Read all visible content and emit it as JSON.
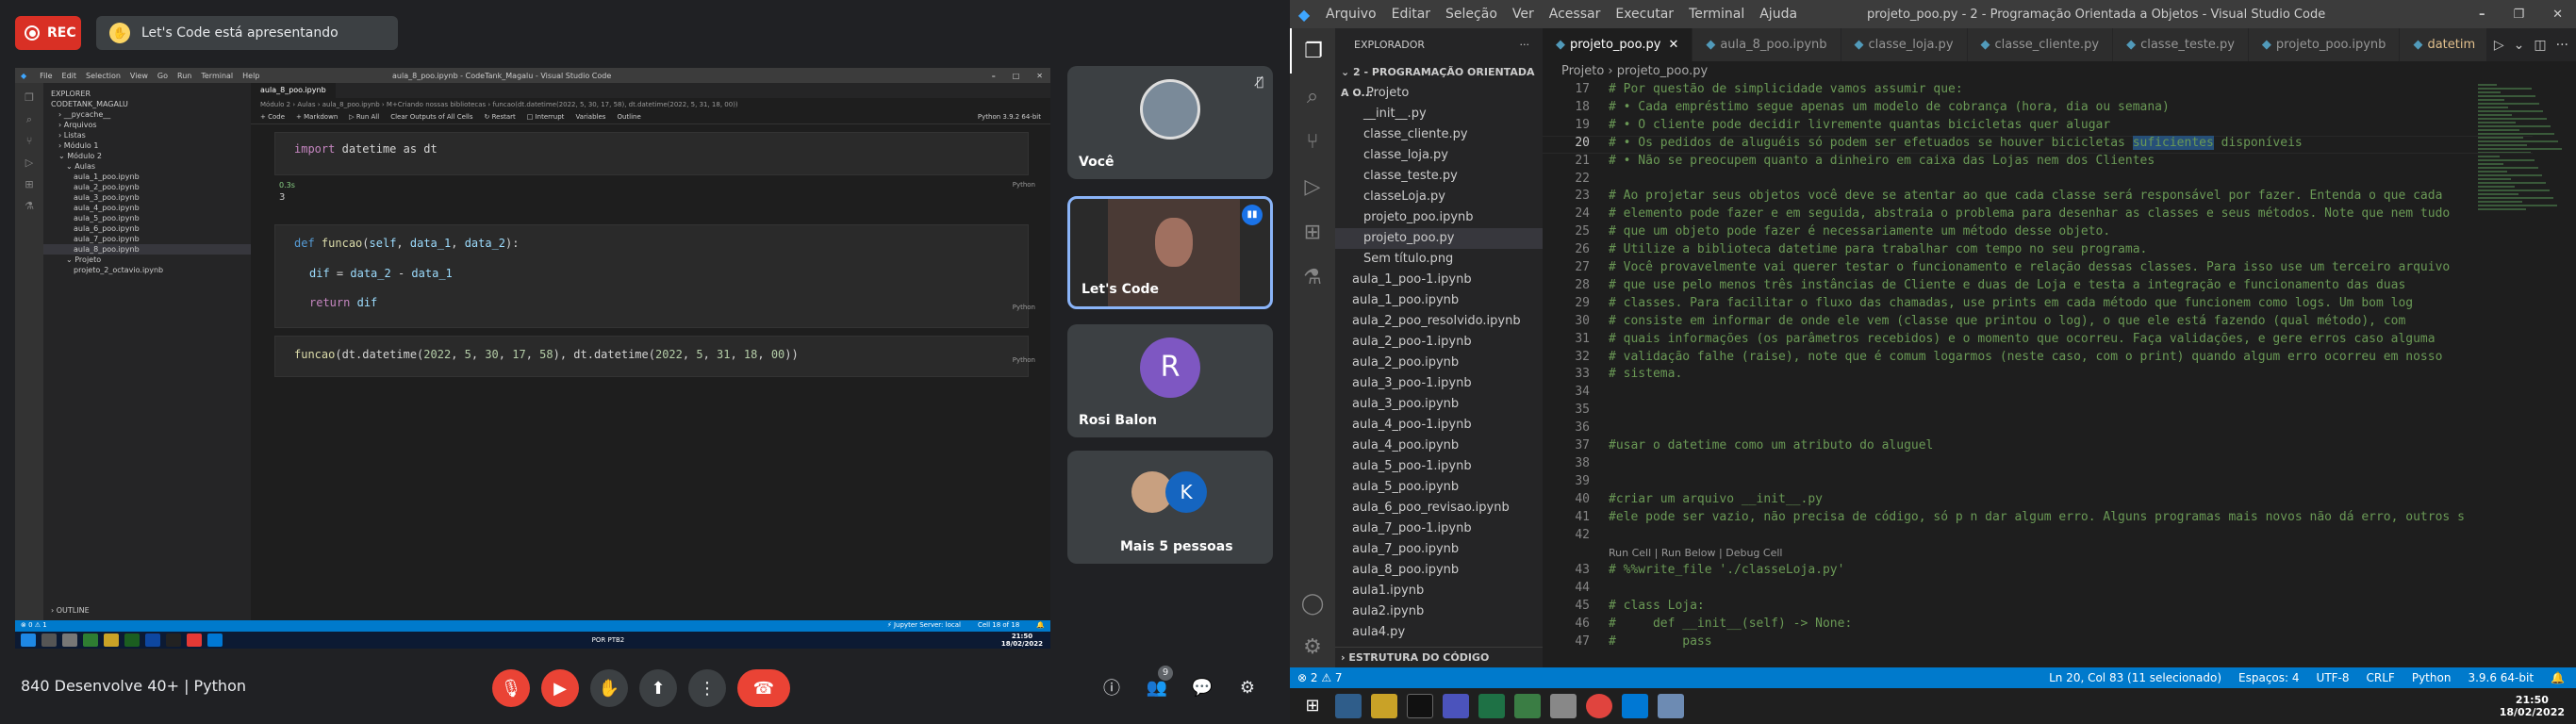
{
  "meet": {
    "rec_label": "REC",
    "presenting": "Let's Code está apresentando",
    "participants": [
      {
        "name": "Você"
      },
      {
        "name": "Let's Code"
      },
      {
        "name": "Rosi Balon",
        "initial": "R"
      },
      {
        "name": "Mais 5 pessoas",
        "initial": "K"
      }
    ],
    "meeting_title": "840 Desenvolve 40+ | Python",
    "people_count": "9"
  },
  "shared": {
    "window_title": "aula_8_poo.ipynb - CodeTank_Magalu - Visual Studio Code",
    "menu": [
      "File",
      "Edit",
      "Selection",
      "View",
      "Go",
      "Run",
      "Terminal",
      "Help"
    ],
    "explorer_title": "EXPLORER",
    "explorer_items": [
      "CODETANK_MAGALU",
      "› __pycache__",
      "› Arquivos",
      "› Listas",
      "› Módulo 1",
      "⌄ Módulo 2",
      "⌄ Aulas",
      "aula_1_poo.ipynb",
      "aula_2_poo.ipynb",
      "aula_3_poo.ipynb",
      "aula_4_poo.ipynb",
      "aula_5_poo.ipynb",
      "aula_6_poo.ipynb",
      "aula_7_poo.ipynb",
      "aula_8_poo.ipynb",
      "⌄ Projeto",
      "projeto_2_octavio.ipynb"
    ],
    "outline": "› OUTLINE",
    "tab": "aula_8_poo.ipynb",
    "breadcrumb": "Módulo 2 › Aulas › aula_8_poo.ipynb › M+Criando nossas bibliotecas › funcao(dt.datetime(2022, 5, 30, 17, 58), dt.datetime(2022, 5, 31, 18, 00))",
    "toolbar": [
      "+ Code",
      "+ Markdown",
      "▷ Run All",
      "Clear Outputs of All Cells",
      "↻ Restart",
      "□ Interrupt",
      "Variables",
      "Outline"
    ],
    "kernel": "Python 3.9.2 64-bit",
    "cell1_code": "import datetime as dt",
    "cell1_time": "0.3s",
    "cell1_output": "3",
    "cell2_lines": [
      "def funcao(self, data_1, data_2):",
      "dif = data_2 - data_1",
      "return dif"
    ],
    "cell3_code": "funcao(dt.datetime(2022, 5, 30, 17, 58), dt.datetime(2022, 5, 31, 18, 00))",
    "lang": "Python",
    "status_left": "⊗ 0 ⚠ 1",
    "status_right": [
      "⚡ Jupyter Server: local",
      "Cell 18 of 18",
      "🔔"
    ],
    "clock_time": "21:50",
    "clock_date": "18/02/2022",
    "lang_indicator": "POR PTB2"
  },
  "vscode": {
    "menu": [
      "Arquivo",
      "Editar",
      "Seleção",
      "Ver",
      "Acessar",
      "Executar",
      "Terminal",
      "Ajuda"
    ],
    "window_title": "projeto_poo.py - 2 - Programação Orientada a Objetos - Visual Studio Code",
    "explorer_title": "EXPLORADOR",
    "workspace": "⌄ 2 - PROGRAMAÇÃO ORIENTADA A O...",
    "files": [
      {
        "name": "⌄ Projeto",
        "indent": 1
      },
      {
        "name": "__init__.py",
        "indent": 2
      },
      {
        "name": "classe_cliente.py",
        "indent": 2
      },
      {
        "name": "classe_loja.py",
        "indent": 2
      },
      {
        "name": "classe_teste.py",
        "indent": 2
      },
      {
        "name": "classeLoja.py",
        "indent": 2
      },
      {
        "name": "projeto_poo.ipynb",
        "indent": 2
      },
      {
        "name": "projeto_poo.py",
        "indent": 2,
        "selected": true
      },
      {
        "name": "Sem título.png",
        "indent": 2
      },
      {
        "name": "aula_1_poo-1.ipynb",
        "indent": 1
      },
      {
        "name": "aula_1_poo.ipynb",
        "indent": 1
      },
      {
        "name": "aula_2_poo_resolvido.ipynb",
        "indent": 1
      },
      {
        "name": "aula_2_poo-1.ipynb",
        "indent": 1
      },
      {
        "name": "aula_2_poo.ipynb",
        "indent": 1
      },
      {
        "name": "aula_3_poo-1.ipynb",
        "indent": 1
      },
      {
        "name": "aula_3_poo.ipynb",
        "indent": 1
      },
      {
        "name": "aula_4_poo-1.ipynb",
        "indent": 1
      },
      {
        "name": "aula_4_poo.ipynb",
        "indent": 1
      },
      {
        "name": "aula_5_poo-1.ipynb",
        "indent": 1
      },
      {
        "name": "aula_5_poo.ipynb",
        "indent": 1
      },
      {
        "name": "aula_6_poo_revisao.ipynb",
        "indent": 1
      },
      {
        "name": "aula_7_poo-1.ipynb",
        "indent": 1
      },
      {
        "name": "aula_7_poo.ipynb",
        "indent": 1
      },
      {
        "name": "aula_8_poo.ipynb",
        "indent": 1
      },
      {
        "name": "aula1.ipynb",
        "indent": 1
      },
      {
        "name": "aula2.ipynb",
        "indent": 1
      },
      {
        "name": "aula4.py",
        "indent": 1
      }
    ],
    "outline_section": "› ESTRUTURA DO CÓDIGO",
    "tabs": [
      {
        "label": "projeto_poo.py",
        "active": true
      },
      {
        "label": "aula_8_poo.ipynb"
      },
      {
        "label": "classe_loja.py"
      },
      {
        "label": "classe_cliente.py"
      },
      {
        "label": "classe_teste.py"
      },
      {
        "label": "projeto_poo.ipynb"
      },
      {
        "label": "datetim"
      }
    ],
    "breadcrumb": "Projeto  ›  projeto_poo.py",
    "lines": [
      {
        "n": "17",
        "t": "# Por questão de simplicidade vamos assumir que:"
      },
      {
        "n": "18",
        "t": "# • Cada empréstimo segue apenas um modelo de cobrança (hora, dia ou semana)"
      },
      {
        "n": "19",
        "t": "# • O cliente pode decidir livremente quantas bicicletas quer alugar"
      },
      {
        "n": "20",
        "t": "# • Os pedidos de aluguéis só podem ser efetuados se houver bicicletas suficientes disponíveis",
        "current": true
      },
      {
        "n": "21",
        "t": "# • Não se preocupem quanto a dinheiro em caixa das Lojas nem dos Clientes"
      },
      {
        "n": "22",
        "t": ""
      },
      {
        "n": "23",
        "t": "# Ao projetar seus objetos você deve se atentar ao que cada classe será responsável por fazer. Entenda o que cada"
      },
      {
        "n": "24",
        "t": "# elemento pode fazer e em seguida, abstraia o problema para desenhar as classes e seus métodos. Note que nem tudo"
      },
      {
        "n": "25",
        "t": "# que um objeto pode fazer é necessariamente um método desse objeto."
      },
      {
        "n": "26",
        "t": "# Utilize a biblioteca datetime para trabalhar com tempo no seu programa."
      },
      {
        "n": "27",
        "t": "# Você provavelmente vai querer testar o funcionamento e relação dessas classes. Para isso use um terceiro arquivo"
      },
      {
        "n": "28",
        "t": "# que use pelo menos três instâncias de Cliente e duas de Loja e testa a integração e funcionamento das duas"
      },
      {
        "n": "29",
        "t": "# classes. Para facilitar o fluxo das chamadas, use prints em cada método que funcionem como logs. Um bom log"
      },
      {
        "n": "30",
        "t": "# consiste em informar de onde ele vem (classe que printou o log), o que ele está fazendo (qual método), com"
      },
      {
        "n": "31",
        "t": "# quais informações (os parâmetros recebidos) e o momento que ocorreu. Faça validações, e gere erros caso alguma"
      },
      {
        "n": "32",
        "t": "# validação falhe (raise), note que é comum logarmos (neste caso, com o print) quando algum erro ocorreu em nosso"
      },
      {
        "n": "33",
        "t": "# sistema."
      },
      {
        "n": "34",
        "t": ""
      },
      {
        "n": "35",
        "t": ""
      },
      {
        "n": "36",
        "t": ""
      },
      {
        "n": "37",
        "t": "#usar o datetime como um atributo do aluguel"
      },
      {
        "n": "38",
        "t": ""
      },
      {
        "n": "39",
        "t": ""
      },
      {
        "n": "40",
        "t": "#criar um arquivo __init__.py"
      },
      {
        "n": "41",
        "t": "#ele pode ser vazio, não precisa de código, só p n dar algum erro. Alguns programas mais novos não dá erro, outros s"
      },
      {
        "n": "42",
        "t": ""
      },
      {
        "n": "",
        "t": "Run Cell | Run Below | Debug Cell",
        "lens": true
      },
      {
        "n": "43",
        "t": "# %%write_file './classeLoja.py'"
      },
      {
        "n": "44",
        "t": ""
      },
      {
        "n": "45",
        "t": "# class Loja:"
      },
      {
        "n": "46",
        "t": "#     def __init__(self) -> None:"
      },
      {
        "n": "47",
        "t": "#         pass"
      }
    ],
    "status_left": "⊗ 2 ⚠ 7",
    "status_right": [
      "Ln 20, Col 83 (11 selecionado)",
      "Espaços: 4",
      "UTF-8",
      "CRLF",
      "Python",
      "3.9.6 64-bit",
      "🔔"
    ],
    "clock_time": "21:50",
    "clock_date": "18/02/2022"
  },
  "colors": {
    "accent": "#007acc",
    "rec": "#d93025",
    "hangup": "#ea4335",
    "tile_active": "#8ab4f8"
  }
}
